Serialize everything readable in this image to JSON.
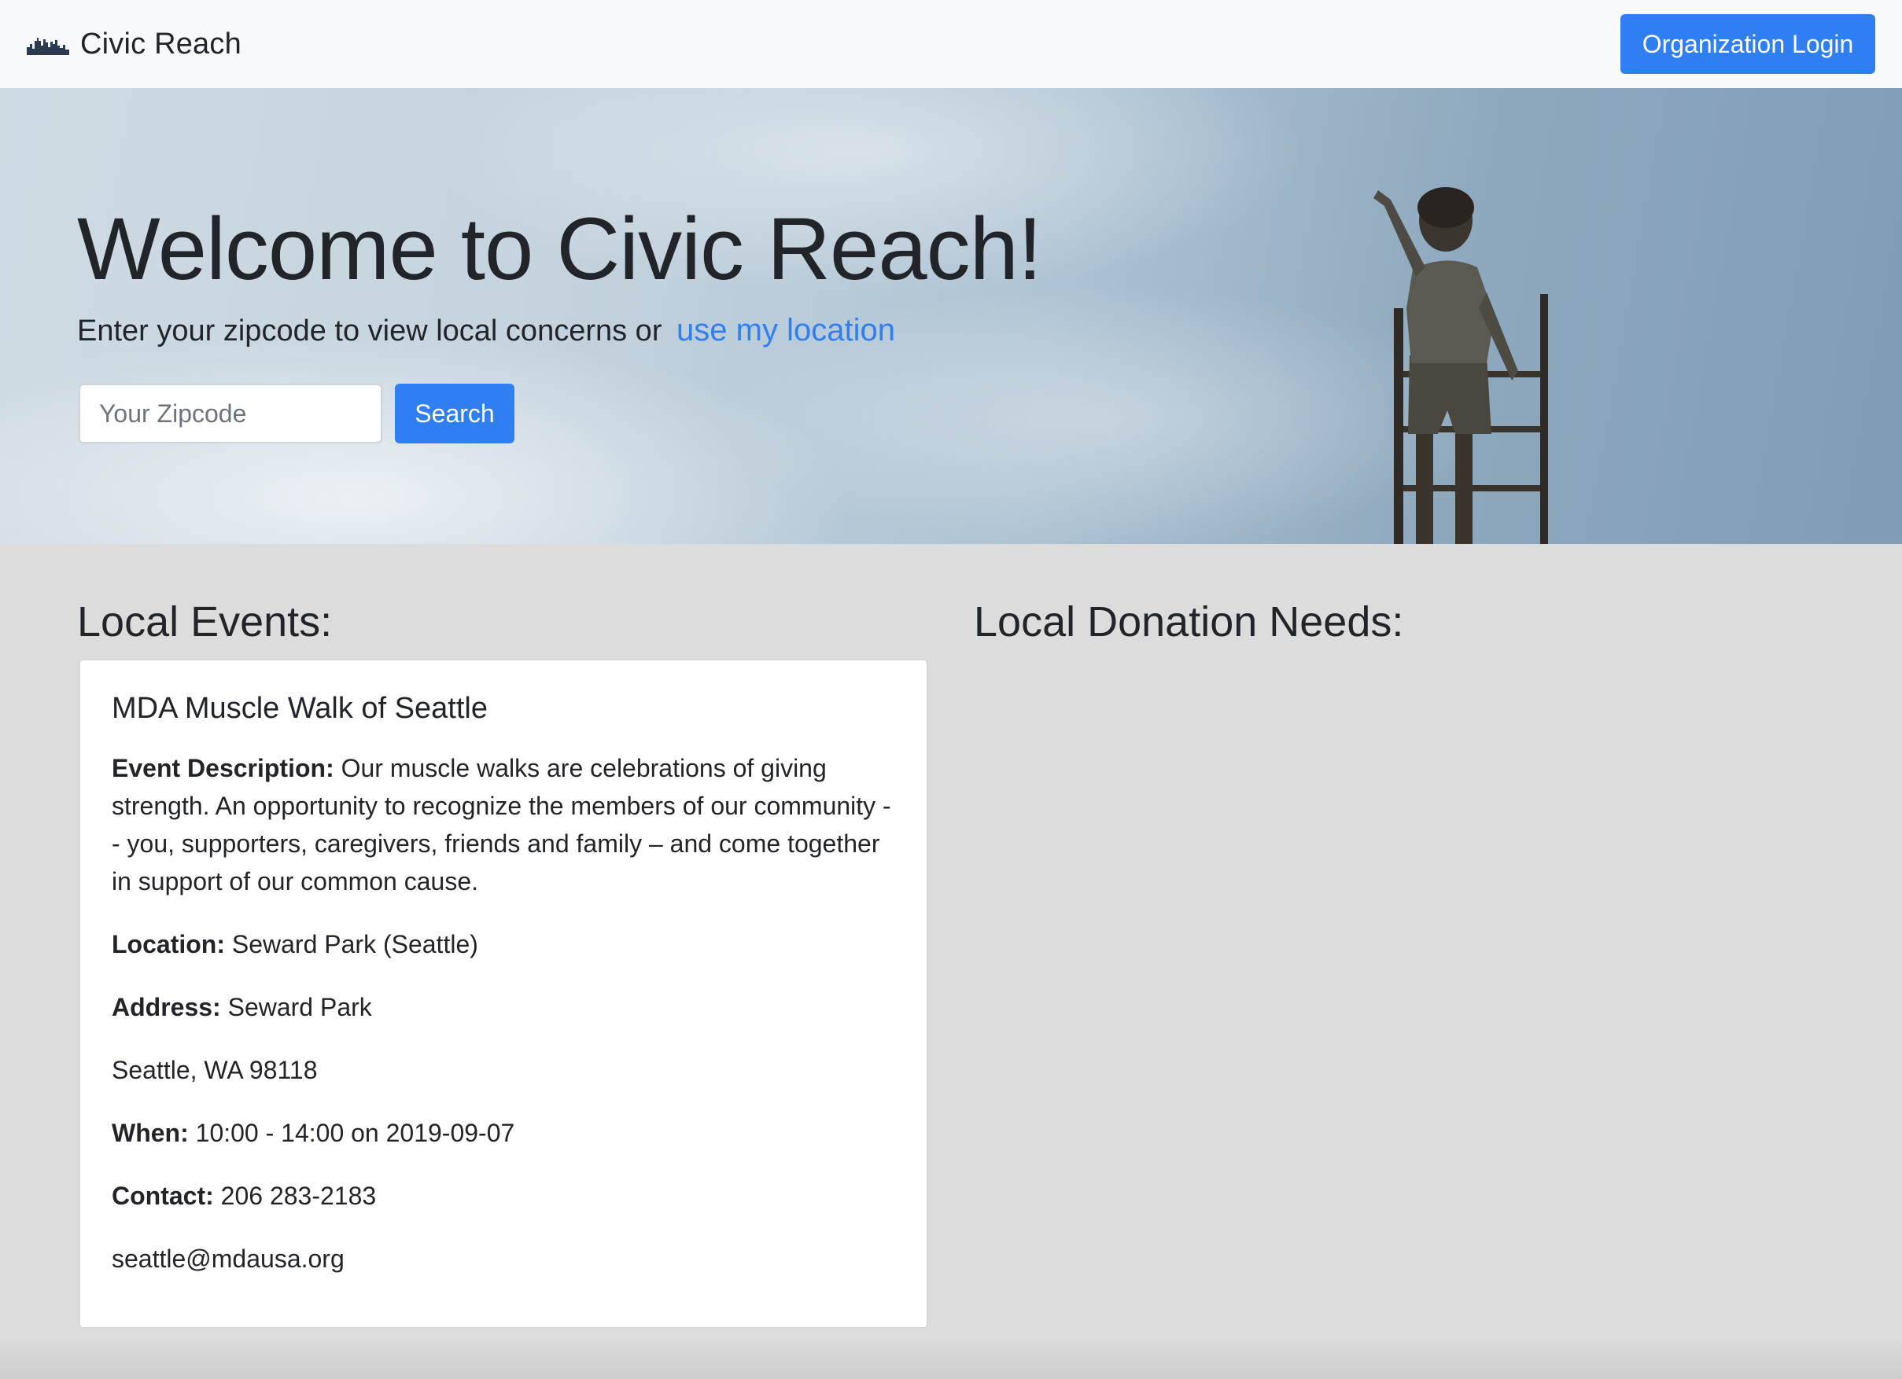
{
  "navbar": {
    "brand_name": "Civic Reach",
    "brand_icon": "city-skyline-icon",
    "login_label": "Organization Login"
  },
  "hero": {
    "title": "Welcome to Civic Reach!",
    "subtitle": "Enter your zipcode to view local concerns or",
    "location_link": "use my location",
    "zip_placeholder": "Your Zipcode",
    "zip_value": "",
    "search_label": "Search"
  },
  "events": {
    "heading": "Local Events:",
    "items": [
      {
        "title": "MDA Muscle Walk of Seattle",
        "description_label": "Event Description:",
        "description": "Our muscle walks are celebrations of giving strength. An opportunity to recognize the members of our community -- you, supporters, caregivers, friends and family – and come together in support of our common cause.",
        "location_label": "Location:",
        "location": "Seward Park (Seattle)",
        "address_label": "Address:",
        "address_line1": "Seward Park",
        "address_line2": "Seattle, WA 98118",
        "when_label": "When:",
        "when": "10:00 - 14:00 on 2019-09-07",
        "contact_label": "Contact:",
        "contact_phone": "206 283-2183",
        "contact_email": "seattle@mdausa.org"
      }
    ]
  },
  "donations": {
    "heading": "Local Donation Needs:"
  },
  "colors": {
    "accent": "#2f7ff2",
    "navbar_bg": "#f8f9fa",
    "page_bg": "#dcdcdc"
  }
}
